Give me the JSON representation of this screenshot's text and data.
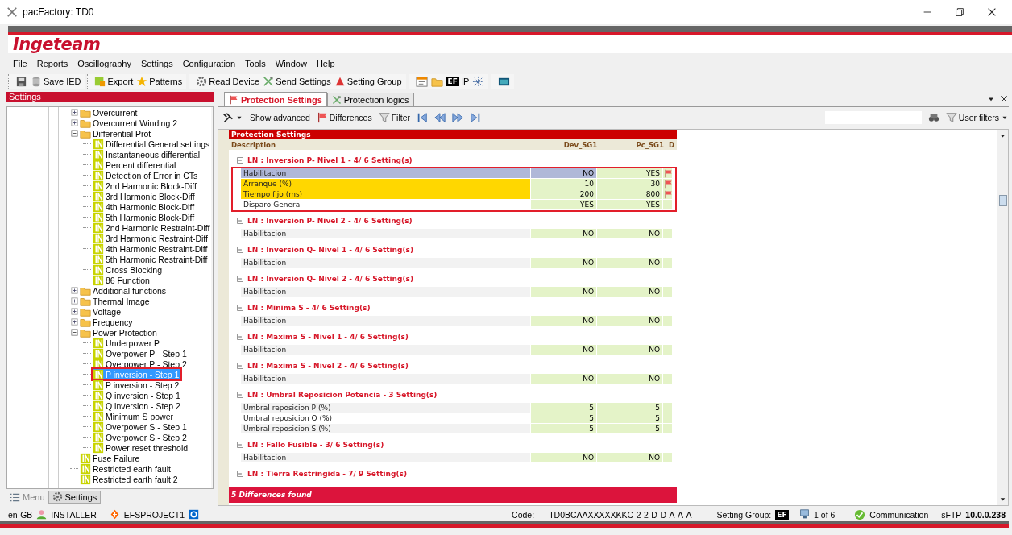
{
  "window": {
    "title": "pacFactory: TD0"
  },
  "brand": {
    "logo": "Ingeteam"
  },
  "menu": [
    "File",
    "Reports",
    "Oscillography",
    "Settings",
    "Configuration",
    "Tools",
    "Window",
    "Help"
  ],
  "toolbar": [
    [
      {
        "kind": "icon"
      },
      {
        "kind": "button",
        "label": "Save IED"
      }
    ],
    [
      {
        "kind": "button",
        "label": "Export"
      },
      {
        "kind": "button",
        "label": "Patterns"
      }
    ],
    [
      {
        "kind": "button",
        "label": "Read Device"
      },
      {
        "kind": "button",
        "label": "Send Settings"
      },
      {
        "kind": "button",
        "label": "Setting Group"
      }
    ],
    [
      {
        "kind": "icon"
      },
      {
        "kind": "icon"
      },
      {
        "kind": "badge",
        "badge": "EF",
        "label": "IP"
      },
      {
        "kind": "icon"
      }
    ],
    [
      {
        "kind": "icon"
      }
    ]
  ],
  "left_panel": {
    "title": "Settings",
    "tree": [
      {
        "label": "Overcurrent",
        "kind": "folder",
        "expanded": false,
        "selected": false
      },
      {
        "label": "Overcurrent Winding 2",
        "kind": "folder",
        "expanded": false,
        "selected": false
      },
      {
        "label": "Differential Prot",
        "kind": "folder",
        "expanded": true,
        "selected": false,
        "children": [
          {
            "label": "Differential General settings",
            "kind": "leaf",
            "selected": false
          },
          {
            "label": "Instantaneous differential",
            "kind": "leaf",
            "selected": false
          },
          {
            "label": "Percent differential",
            "kind": "leaf",
            "selected": false
          },
          {
            "label": "Detection of Error in CTs",
            "kind": "leaf",
            "selected": false
          },
          {
            "label": "2nd Harmonic Block-Diff",
            "kind": "leaf",
            "selected": false
          },
          {
            "label": "3rd Harmonic Block-Diff",
            "kind": "leaf",
            "selected": false
          },
          {
            "label": "4th Harmonic Block-Diff",
            "kind": "leaf",
            "selected": false
          },
          {
            "label": "5th Harmonic Block-Diff",
            "kind": "leaf",
            "selected": false
          },
          {
            "label": "2nd Harmonic Restraint-Diff",
            "kind": "leaf",
            "selected": false
          },
          {
            "label": "3rd Harmonic Restraint-Diff",
            "kind": "leaf",
            "selected": false
          },
          {
            "label": "4th Harmonic Restraint-Diff",
            "kind": "leaf",
            "selected": false
          },
          {
            "label": "5th Harmonic Restraint-Diff",
            "kind": "leaf",
            "selected": false
          },
          {
            "label": "Cross Blocking",
            "kind": "leaf",
            "selected": false
          },
          {
            "label": "86 Function",
            "kind": "leaf",
            "selected": false
          }
        ]
      },
      {
        "label": "Additional functions",
        "kind": "folder",
        "expanded": false,
        "selected": false
      },
      {
        "label": "Thermal Image",
        "kind": "folder",
        "expanded": false,
        "selected": false
      },
      {
        "label": "Voltage",
        "kind": "folder",
        "expanded": false,
        "selected": false
      },
      {
        "label": "Frequency",
        "kind": "folder",
        "expanded": false,
        "selected": false
      },
      {
        "label": "Power Protection",
        "kind": "folder",
        "expanded": true,
        "selected": false,
        "children": [
          {
            "label": "Underpower P",
            "kind": "leaf",
            "selected": false
          },
          {
            "label": "Overpower P - Step 1",
            "kind": "leaf",
            "selected": false
          },
          {
            "label": "Overpower P - Step 2",
            "kind": "leaf",
            "selected": false
          },
          {
            "label": "P inversion - Step 1",
            "kind": "leaf",
            "selected": true
          },
          {
            "label": "P inversion - Step 2",
            "kind": "leaf",
            "selected": false
          },
          {
            "label": "Q inversion - Step 1",
            "kind": "leaf",
            "selected": false
          },
          {
            "label": "Q inversion - Step 2",
            "kind": "leaf",
            "selected": false
          },
          {
            "label": "Minimum S power",
            "kind": "leaf",
            "selected": false
          },
          {
            "label": "Overpower S - Step 1",
            "kind": "leaf",
            "selected": false
          },
          {
            "label": "Overpower S - Step 2",
            "kind": "leaf",
            "selected": false
          },
          {
            "label": "Power reset threshold",
            "kind": "leaf",
            "selected": false
          }
        ]
      },
      {
        "label": "Fuse Failure",
        "kind": "leaf",
        "selected": false
      },
      {
        "label": "Restricted earth fault",
        "kind": "leaf",
        "selected": false
      },
      {
        "label": "Restricted earth fault 2",
        "kind": "leaf",
        "selected": false
      }
    ],
    "tabs": [
      {
        "label": "Menu",
        "selected": false
      },
      {
        "label": "Settings",
        "selected": true
      }
    ]
  },
  "doc_tabs": [
    {
      "label": "Protection Settings",
      "selected": true
    },
    {
      "label": "Protection logics",
      "selected": false
    }
  ],
  "grid_toolbar": [
    {
      "kind": "dropdown"
    },
    {
      "kind": "button",
      "label": "Show advanced"
    },
    {
      "kind": "button",
      "label": "Differences"
    },
    {
      "kind": "button",
      "label": "Filter"
    },
    {
      "kind": "button"
    },
    {
      "kind": "button"
    },
    {
      "kind": "button"
    },
    {
      "kind": "button"
    },
    {
      "kind": "search"
    },
    {
      "kind": "button"
    },
    {
      "kind": "dropdown",
      "label": "User filters"
    }
  ],
  "grid": {
    "title": "Protection Settings",
    "columns": [
      "Description",
      "Dev_SG1",
      "Pc_SG1",
      "D"
    ],
    "groups": [
      {
        "title": "LN : Inversion P- Nivel 1 - 4/ 6 Setting(s)",
        "expanded": true,
        "highlighted": true,
        "rows": [
          {
            "description": "Habilitacion",
            "dev": "NO",
            "pc": "YES",
            "different": true,
            "selected": true
          },
          {
            "description": "Arranque (%)",
            "dev": "10",
            "pc": "30",
            "different": true,
            "selected": false
          },
          {
            "description": "Tiempo fijo (ms)",
            "dev": "200",
            "pc": "800",
            "different": true,
            "selected": false
          },
          {
            "description": "Disparo General",
            "dev": "YES",
            "pc": "YES",
            "different": false,
            "selected": false
          }
        ]
      },
      {
        "title": "LN : Inversion P- Nivel 2 - 4/ 6 Setting(s)",
        "expanded": true,
        "highlighted": false,
        "rows": [
          {
            "description": "Habilitacion",
            "dev": "NO",
            "pc": "NO",
            "different": false,
            "selected": false
          }
        ]
      },
      {
        "title": "LN : Inversion Q- Nivel 1 - 4/ 6 Setting(s)",
        "expanded": true,
        "highlighted": false,
        "rows": [
          {
            "description": "Habilitacion",
            "dev": "NO",
            "pc": "NO",
            "different": false,
            "selected": false
          }
        ]
      },
      {
        "title": "LN : Inversion Q- Nivel 2 - 4/ 6 Setting(s)",
        "expanded": true,
        "highlighted": false,
        "rows": [
          {
            "description": "Habilitacion",
            "dev": "NO",
            "pc": "NO",
            "different": false,
            "selected": false
          }
        ]
      },
      {
        "title": "LN : Minima S - 4/ 6 Setting(s)",
        "expanded": true,
        "highlighted": false,
        "rows": [
          {
            "description": "Habilitacion",
            "dev": "NO",
            "pc": "NO",
            "different": false,
            "selected": false
          }
        ]
      },
      {
        "title": "LN : Maxima S - Nivel 1 - 4/ 6 Setting(s)",
        "expanded": true,
        "highlighted": false,
        "rows": [
          {
            "description": "Habilitacion",
            "dev": "NO",
            "pc": "NO",
            "different": false,
            "selected": false
          }
        ]
      },
      {
        "title": "LN : Maxima S - Nivel 2 - 4/ 6 Setting(s)",
        "expanded": true,
        "highlighted": false,
        "rows": [
          {
            "description": "Habilitacion",
            "dev": "NO",
            "pc": "NO",
            "different": false,
            "selected": false
          }
        ]
      },
      {
        "title": "LN : Umbral Reposicion Potencia - 3 Setting(s)",
        "expanded": true,
        "highlighted": false,
        "rows": [
          {
            "description": "Umbral reposicion P (%)",
            "dev": "5",
            "pc": "5",
            "different": false,
            "selected": false
          },
          {
            "description": "Umbral reposicion Q (%)",
            "dev": "5",
            "pc": "5",
            "different": false,
            "selected": false
          },
          {
            "description": "Umbral reposicion S (%)",
            "dev": "5",
            "pc": "5",
            "different": false,
            "selected": false
          }
        ]
      },
      {
        "title": "LN : Fallo Fusible - 3/ 6 Setting(s)",
        "expanded": true,
        "highlighted": false,
        "rows": [
          {
            "description": "Habilitacion",
            "dev": "NO",
            "pc": "NO",
            "different": false,
            "selected": false
          }
        ]
      },
      {
        "title": "LN : Tierra Restringida - 7/ 9 Setting(s)",
        "expanded": true
      }
    ],
    "footer": "5 Differences found"
  },
  "status_bar": {
    "locale": "en-GB",
    "user": "INSTALLER",
    "project": "EFSPROJECT1",
    "code_label": "Code:",
    "code": "TD0BCAAXXXXXKKC-2-2-D-D-A-A-A--",
    "group_label": "Setting Group:",
    "group_badge": "EF",
    "separator": "-",
    "group_count": "1 of 6",
    "communication": "Communication",
    "protocol": "sFTP",
    "ip": "10.0.0.238"
  }
}
